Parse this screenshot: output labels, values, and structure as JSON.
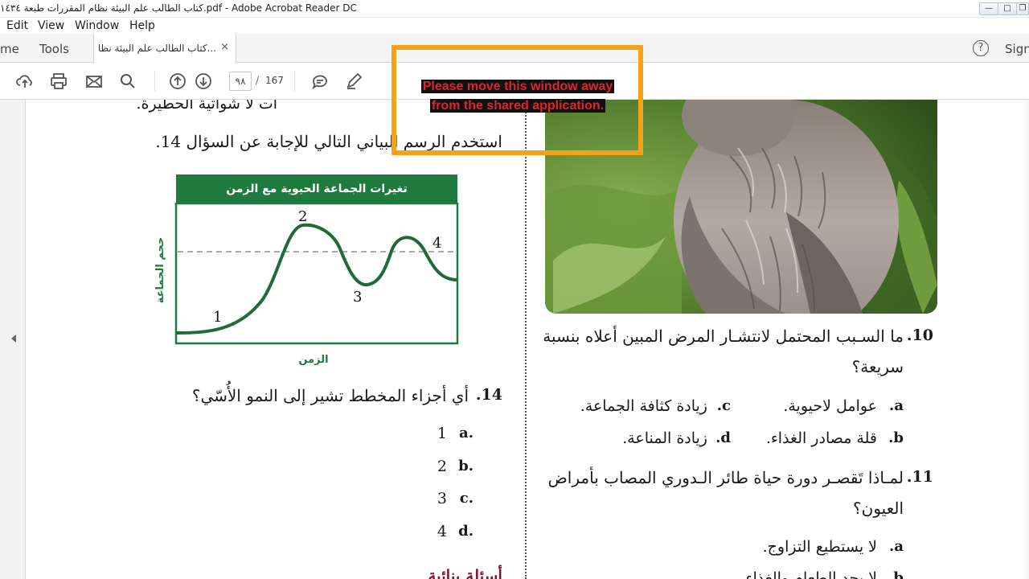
{
  "window": {
    "title": "كتاب الطالب علم البيئة نظام المقررات طبعة ١٤٣٤.pdf - Adobe Acrobat Reader DC",
    "controls": [
      "—",
      "□",
      "❐"
    ]
  },
  "menu": {
    "items": [
      "Edit",
      "View",
      "Window",
      "Help"
    ]
  },
  "tabs": {
    "home": "me",
    "tools": "Tools",
    "document": "كتاب الطالب علم البيئة نظا...",
    "close": "×",
    "help": "?",
    "sign_in": "Sign"
  },
  "toolbar": {
    "current_page": "٩٨",
    "separator": "/",
    "total_pages": "167",
    "icons": [
      "upload-icon",
      "print-icon",
      "mail-icon",
      "search-icon",
      "page-up-icon",
      "page-down-icon",
      "comment-icon",
      "pen-icon"
    ]
  },
  "overlay": {
    "line1": "Please move this window away",
    "line2": "from the shared application.",
    "border_color": "#f5a21a",
    "text_color": "#e0242b"
  },
  "left_page": {
    "cut_top_text": "ات لا شواتية الحطيرة.",
    "intro": "استخدم الرسم البياني التالي للإجابة عن السؤال 14.",
    "chart": {
      "title": "تغيرات الجماعة الحيوية مع الزمن",
      "ylabel": "حجم الجماعة",
      "xlabel": "الزمن",
      "points": [
        "1",
        "2",
        "3",
        "4"
      ]
    },
    "question14": {
      "number": "14.",
      "text": "أي أجزاء المخطط تشير إلى النمو الأُسّي؟",
      "options": [
        {
          "letter": ".a",
          "value": "1"
        },
        {
          "letter": ".b",
          "value": "2"
        },
        {
          "letter": ".c",
          "value": "3"
        },
        {
          "letter": ".d",
          "value": "4"
        }
      ]
    },
    "bottom_heading": "أسئلة بنائية"
  },
  "right_page": {
    "question10": {
      "number": "10.",
      "line1": "ما السـبب المحتمل لانتشـار المرض المبين أعلاه بنسبة",
      "line2": "سريعة؟",
      "options": [
        {
          "letter": "a.",
          "text": "عوامل لاحيوية."
        },
        {
          "letter": "c.",
          "text": "زيادة كثافة الجماعة."
        },
        {
          "letter": "b.",
          "text": "قلة مصادر الغذاء."
        },
        {
          "letter": "d.",
          "text": "زيادة المناعة."
        }
      ]
    },
    "question11": {
      "number": "11.",
      "line1": "لمـاذا تَقصـر دورة حياة طائر الـدوري المصاب بأمراض",
      "line2": "العيون؟",
      "options": [
        {
          "letter": "a.",
          "text": "لا يستطيع التزاوج."
        },
        {
          "letter": "b.",
          "text": "لا يجد الطعام والغذاء."
        }
      ]
    }
  },
  "colors": {
    "chart_green": "#1f7a3e",
    "heading_maroon": "#7a1630",
    "bird_bg": "#5f8a3a"
  }
}
